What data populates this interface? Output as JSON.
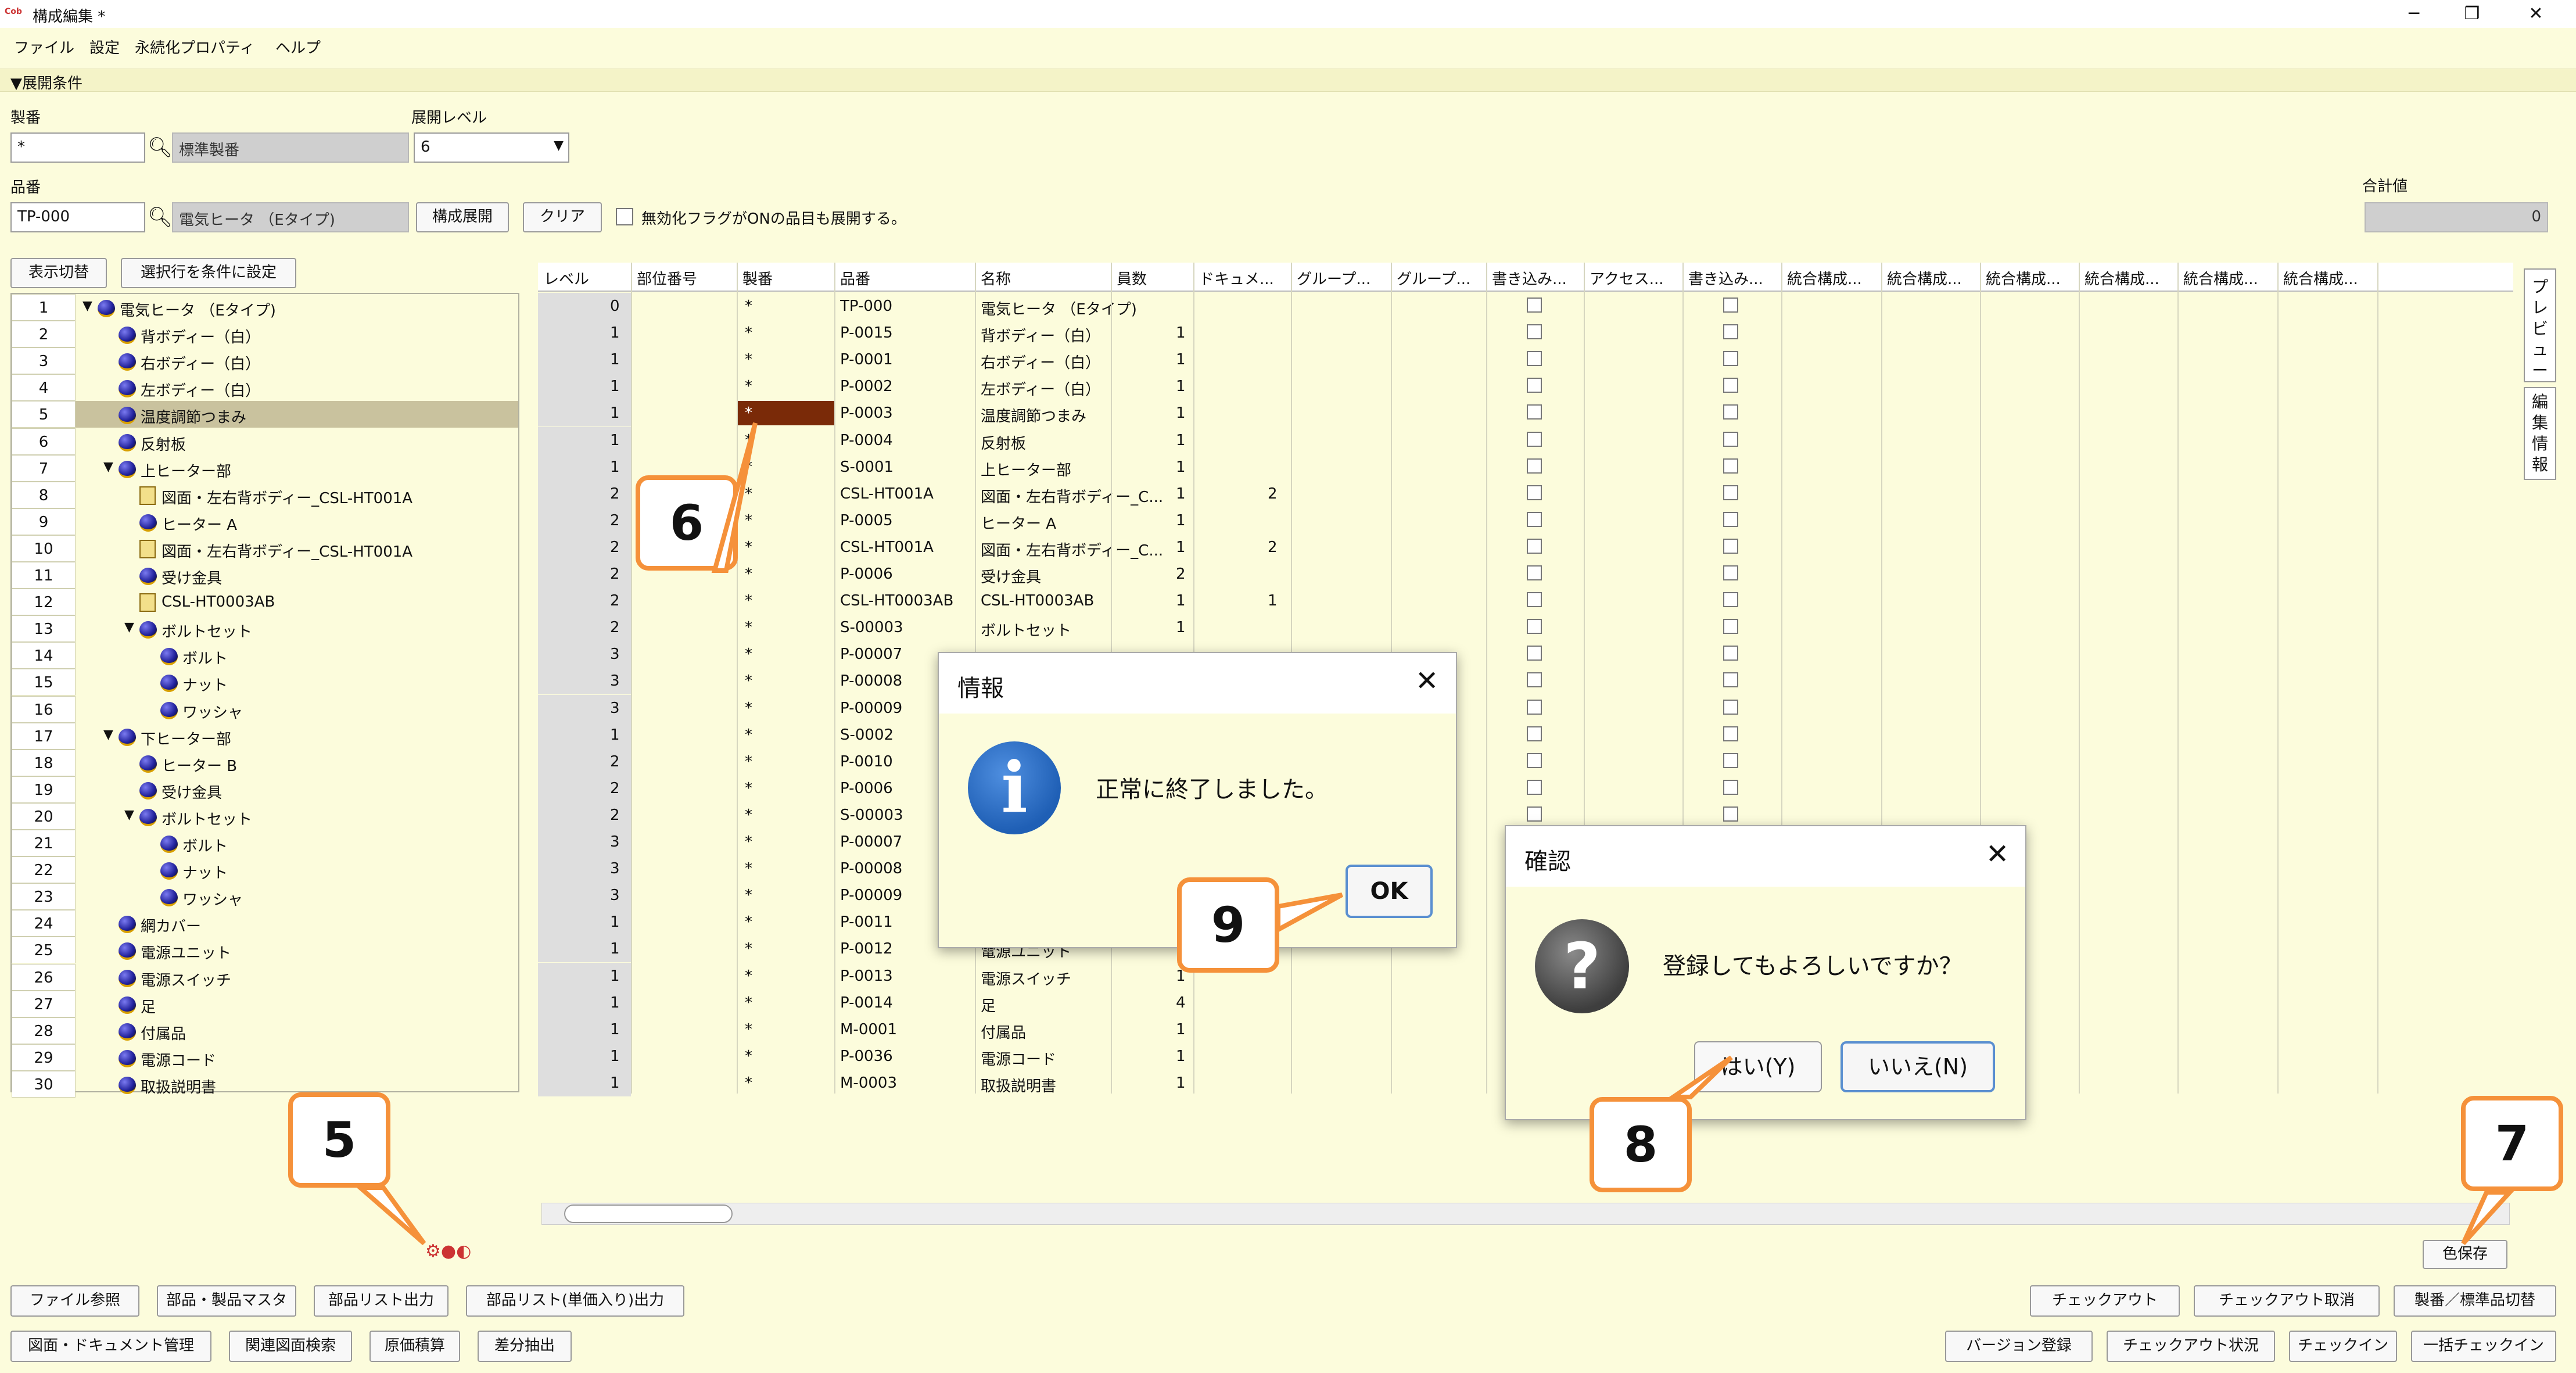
{
  "window": {
    "title": "構成編集 *",
    "minimize": "─",
    "restore": "❐",
    "close": "✕"
  },
  "menu": [
    "ファイル",
    "設定",
    "永続化プロパティ",
    "ヘルプ"
  ],
  "section": {
    "label": "▼展開条件"
  },
  "conditions": {
    "seiban_label": "製番",
    "seiban_value": "*",
    "seiban_name": "標準製番",
    "level_label": "展開レベル",
    "level_value": "6",
    "hinban_label": "品番",
    "hinban_value": "TP-000",
    "hinban_name": "電気ヒータ （Eタイプ)",
    "expand_button": "構成展開",
    "clear_button": "クリア",
    "checkbox_label": "無効化フラグがONの品目も展開する。",
    "total_label": "合計値",
    "total_value": "0"
  },
  "tree_buttons": {
    "toggle": "表示切替",
    "set_condition": "選択行を条件に設定"
  },
  "tree": [
    {
      "n": "1",
      "label": "電気ヒータ （Eタイプ)",
      "indent": 0,
      "type": "ball",
      "exp": "▼"
    },
    {
      "n": "2",
      "label": "背ボディー（白）",
      "indent": 1,
      "type": "ball"
    },
    {
      "n": "3",
      "label": "右ボディー（白）",
      "indent": 1,
      "type": "ball"
    },
    {
      "n": "4",
      "label": "左ボディー（白）",
      "indent": 1,
      "type": "ball"
    },
    {
      "n": "5",
      "label": "温度調節つまみ",
      "indent": 1,
      "type": "ball",
      "sel": true
    },
    {
      "n": "6",
      "label": "反射板",
      "indent": 1,
      "type": "ball"
    },
    {
      "n": "7",
      "label": "上ヒーター部",
      "indent": 1,
      "type": "ball",
      "exp": "▼"
    },
    {
      "n": "8",
      "label": "図面・左右背ボディー_CSL-HT001A",
      "indent": 2,
      "type": "doc"
    },
    {
      "n": "9",
      "label": "ヒーター A",
      "indent": 2,
      "type": "ball"
    },
    {
      "n": "10",
      "label": "図面・左右背ボディー_CSL-HT001A",
      "indent": 2,
      "type": "doc"
    },
    {
      "n": "11",
      "label": "受け金具",
      "indent": 2,
      "type": "ball"
    },
    {
      "n": "12",
      "label": "CSL-HT0003AB",
      "indent": 2,
      "type": "doc"
    },
    {
      "n": "13",
      "label": "ボルトセット",
      "indent": 2,
      "type": "ball",
      "exp": "▼"
    },
    {
      "n": "14",
      "label": "ボルト",
      "indent": 3,
      "type": "ball"
    },
    {
      "n": "15",
      "label": "ナット",
      "indent": 3,
      "type": "ball"
    },
    {
      "n": "16",
      "label": "ワッシャ",
      "indent": 3,
      "type": "ball"
    },
    {
      "n": "17",
      "label": "下ヒーター部",
      "indent": 1,
      "type": "ball",
      "exp": "▼"
    },
    {
      "n": "18",
      "label": "ヒーター B",
      "indent": 2,
      "type": "ball"
    },
    {
      "n": "19",
      "label": "受け金具",
      "indent": 2,
      "type": "ball"
    },
    {
      "n": "20",
      "label": "ボルトセット",
      "indent": 2,
      "type": "ball",
      "exp": "▼"
    },
    {
      "n": "21",
      "label": "ボルト",
      "indent": 3,
      "type": "ball"
    },
    {
      "n": "22",
      "label": "ナット",
      "indent": 3,
      "type": "ball"
    },
    {
      "n": "23",
      "label": "ワッシャ",
      "indent": 3,
      "type": "ball"
    },
    {
      "n": "24",
      "label": "網カバー",
      "indent": 1,
      "type": "ball"
    },
    {
      "n": "25",
      "label": "電源ユニット",
      "indent": 1,
      "type": "ball"
    },
    {
      "n": "26",
      "label": "電源スイッチ",
      "indent": 1,
      "type": "ball"
    },
    {
      "n": "27",
      "label": "足",
      "indent": 1,
      "type": "ball"
    },
    {
      "n": "28",
      "label": "付属品",
      "indent": 1,
      "type": "ball"
    },
    {
      "n": "29",
      "label": "電源コード",
      "indent": 1,
      "type": "ball"
    },
    {
      "n": "30",
      "label": "取扱説明書",
      "indent": 1,
      "type": "ball"
    }
  ],
  "grid": {
    "headers": [
      "レベル",
      "部位番号",
      "製番",
      "品番",
      "名称",
      "員数",
      "ドキュメ...",
      "グループ...",
      "グループ...",
      "書き込み...",
      "アクセス...",
      "書き込み...",
      "統合構成...",
      "統合構成...",
      "統合構成...",
      "統合構成...",
      "統合構成...",
      "統合構成..."
    ],
    "rows": [
      {
        "level": "0",
        "seiban": "*",
        "hinban": "TP-000",
        "name": "電気ヒータ （Eタイプ)",
        "qty": "",
        "doc": ""
      },
      {
        "level": "1",
        "seiban": "*",
        "hinban": "P-0015",
        "name": "背ボディー（白）",
        "qty": "1",
        "doc": ""
      },
      {
        "level": "1",
        "seiban": "*",
        "hinban": "P-0001",
        "name": "右ボディー（白）",
        "qty": "1",
        "doc": ""
      },
      {
        "level": "1",
        "seiban": "*",
        "hinban": "P-0002",
        "name": "左ボディー（白）",
        "qty": "1",
        "doc": ""
      },
      {
        "level": "1",
        "seiban": "*",
        "hinban": "P-0003",
        "name": "温度調節つまみ",
        "qty": "1",
        "doc": "",
        "colored": true
      },
      {
        "level": "1",
        "seiban": "*",
        "hinban": "P-0004",
        "name": "反射板",
        "qty": "1",
        "doc": ""
      },
      {
        "level": "1",
        "seiban": "*",
        "hinban": "S-0001",
        "name": "上ヒーター部",
        "qty": "1",
        "doc": ""
      },
      {
        "level": "2",
        "seiban": "*",
        "hinban": "CSL-HT001A",
        "name": "図面・左右背ボディー_C...",
        "qty": "1",
        "doc": "2"
      },
      {
        "level": "2",
        "seiban": "*",
        "hinban": "P-0005",
        "name": "ヒーター A",
        "qty": "1",
        "doc": ""
      },
      {
        "level": "2",
        "seiban": "*",
        "hinban": "CSL-HT001A",
        "name": "図面・左右背ボディー_C...",
        "qty": "1",
        "doc": "2"
      },
      {
        "level": "2",
        "seiban": "*",
        "hinban": "P-0006",
        "name": "受け金具",
        "qty": "2",
        "doc": ""
      },
      {
        "level": "2",
        "seiban": "*",
        "hinban": "CSL-HT0003AB",
        "name": "CSL-HT0003AB",
        "qty": "1",
        "doc": "1"
      },
      {
        "level": "2",
        "seiban": "*",
        "hinban": "S-00003",
        "name": "ボルトセット",
        "qty": "1",
        "doc": ""
      },
      {
        "level": "3",
        "seiban": "*",
        "hinban": "P-00007",
        "name": "",
        "qty": "",
        "doc": ""
      },
      {
        "level": "3",
        "seiban": "*",
        "hinban": "P-00008",
        "name": "",
        "qty": "",
        "doc": ""
      },
      {
        "level": "3",
        "seiban": "*",
        "hinban": "P-00009",
        "name": "",
        "qty": "",
        "doc": ""
      },
      {
        "level": "1",
        "seiban": "*",
        "hinban": "S-0002",
        "name": "",
        "qty": "",
        "doc": ""
      },
      {
        "level": "2",
        "seiban": "*",
        "hinban": "P-0010",
        "name": "",
        "qty": "",
        "doc": ""
      },
      {
        "level": "2",
        "seiban": "*",
        "hinban": "P-0006",
        "name": "",
        "qty": "",
        "doc": ""
      },
      {
        "level": "2",
        "seiban": "*",
        "hinban": "S-00003",
        "name": "",
        "qty": "",
        "doc": ""
      },
      {
        "level": "3",
        "seiban": "*",
        "hinban": "P-00007",
        "name": "",
        "qty": "",
        "doc": ""
      },
      {
        "level": "3",
        "seiban": "*",
        "hinban": "P-00008",
        "name": "",
        "qty": "",
        "doc": ""
      },
      {
        "level": "3",
        "seiban": "*",
        "hinban": "P-00009",
        "name": "",
        "qty": "",
        "doc": ""
      },
      {
        "level": "1",
        "seiban": "*",
        "hinban": "P-0011",
        "name": "",
        "qty": "",
        "doc": ""
      },
      {
        "level": "1",
        "seiban": "*",
        "hinban": "P-0012",
        "name": "電源ユニット",
        "qty": "",
        "doc": ""
      },
      {
        "level": "1",
        "seiban": "*",
        "hinban": "P-0013",
        "name": "電源スイッチ",
        "qty": "1",
        "doc": ""
      },
      {
        "level": "1",
        "seiban": "*",
        "hinban": "P-0014",
        "name": "足",
        "qty": "4",
        "doc": ""
      },
      {
        "level": "1",
        "seiban": "*",
        "hinban": "M-0001",
        "name": "付属品",
        "qty": "1",
        "doc": ""
      },
      {
        "level": "1",
        "seiban": "*",
        "hinban": "P-0036",
        "name": "電源コード",
        "qty": "1",
        "doc": ""
      },
      {
        "level": "1",
        "seiban": "*",
        "hinban": "M-0003",
        "name": "取扱説明書",
        "qty": "1",
        "doc": ""
      }
    ]
  },
  "side_tabs": {
    "preview": "プレビュー",
    "edit_info": "編集情報"
  },
  "color_save": "色保存",
  "dialog_info": {
    "title": "情報",
    "message": "正常に終了しました。",
    "ok": "OK",
    "close": "✕"
  },
  "dialog_confirm": {
    "title": "確認",
    "message": "登録してもよろしいですか？",
    "yes": "はい(Y)",
    "no": "いいえ(N)",
    "close": "✕"
  },
  "callouts": {
    "c5": "5",
    "c6": "6",
    "c7": "7",
    "c8": "8",
    "c9": "9"
  },
  "bottom_left_row1": [
    "ファイル参照",
    "部品・製品マスタ",
    "部品リスト出力",
    "部品リスト(単価入り)出力"
  ],
  "bottom_left_row2": [
    "図面・ドキュメント管理",
    "関連図面検索",
    "原価積算",
    "差分抽出"
  ],
  "bottom_right_row1": [
    "チェックアウト",
    "チェックアウト取消",
    "製番／標準品切替"
  ],
  "bottom_right_row2": [
    "バージョン登録",
    "チェックアウト状況",
    "チェックイン",
    "一括チェックイン"
  ],
  "colors": {
    "background": "#fcfcdc",
    "accent": "#f5913a",
    "selected_cell": "#7a2a08",
    "info_icon": "#1f5fb5"
  }
}
